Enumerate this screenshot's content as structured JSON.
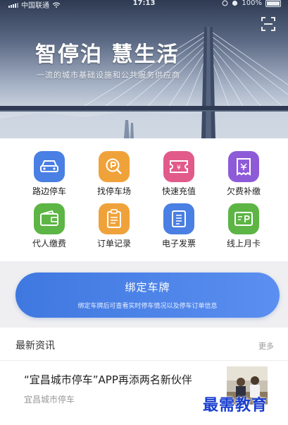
{
  "status_bar": {
    "carrier": "中国联通",
    "time": "17:13",
    "battery": "100%"
  },
  "hero": {
    "title": "智停泊 慧生活",
    "subtitle": "一流的城市基础设施和公共服务供应商",
    "scan_icon": "scan-icon"
  },
  "services": [
    {
      "label": "路边停车",
      "icon": "car-icon",
      "color": "#4a7fe3"
    },
    {
      "label": "找停车场",
      "icon": "parking-search-icon",
      "color": "#f0a23a"
    },
    {
      "label": "快速充值",
      "icon": "ticket-icon",
      "color": "#e25a8a"
    },
    {
      "label": "欠费补缴",
      "icon": "bill-icon",
      "color": "#8e5bd8"
    },
    {
      "label": "代人缴费",
      "icon": "wallet-icon",
      "color": "#5cb544"
    },
    {
      "label": "订单记录",
      "icon": "clipboard-icon",
      "color": "#f0a23a"
    },
    {
      "label": "电子发票",
      "icon": "invoice-icon",
      "color": "#4a7fe3"
    },
    {
      "label": "线上月卡",
      "icon": "parking-card-icon",
      "color": "#5cb544"
    }
  ],
  "bind": {
    "title": "绑定车牌",
    "description": "绑定车牌后可查看实时停车情况以及停车订单信息"
  },
  "news": {
    "section_title": "最新资讯",
    "more_label": "更多",
    "items": [
      {
        "headline": "“宜昌城市停车”APP再添两名新伙伴",
        "source": "宜昌城市停车"
      }
    ]
  },
  "watermark": "最需教育"
}
